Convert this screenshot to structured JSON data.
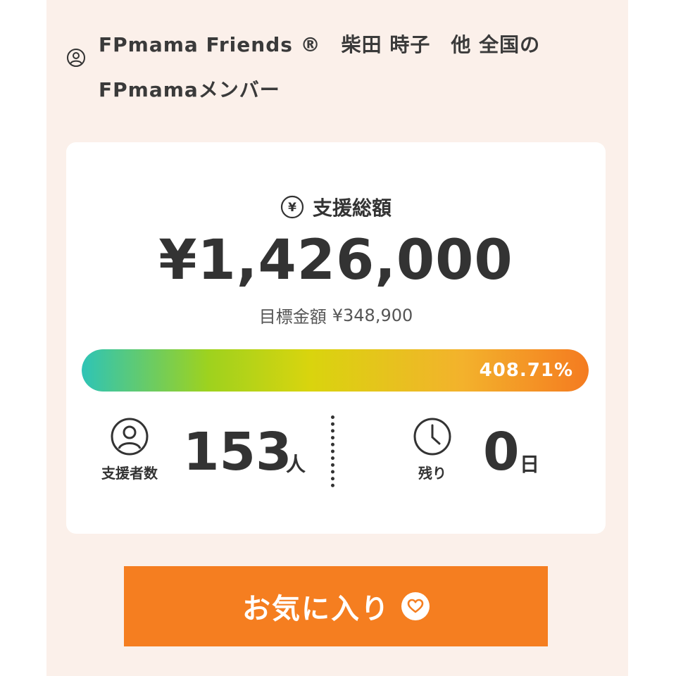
{
  "project_owner": {
    "icon": "user-circle-icon",
    "name": "FPmama Friends ®　柴田 時子　他 全国のFPmamaメンバー"
  },
  "funding": {
    "total_icon": "yen-icon",
    "total_label": "支援総額",
    "total_amount": "¥1,426,000",
    "goal_label": "目標金額",
    "goal_amount": "¥348,900",
    "progress_text": "408.71%",
    "progress_fill_fraction": 1.0,
    "gradient_colors": [
      "#2ec4b6",
      "#9ed21e",
      "#d9d40e",
      "#f3b22c",
      "#f47b20"
    ]
  },
  "stats": {
    "supporters": {
      "icon": "user-circle-icon",
      "label": "支援者数",
      "value": "153",
      "unit": "人"
    },
    "remaining": {
      "icon": "clock-icon",
      "label": "残り",
      "value": "0",
      "unit": "日"
    }
  },
  "favorite_button": {
    "label": "お気に入り",
    "icon": "heart-icon",
    "color": "#f57e20"
  },
  "colors": {
    "page_background": "#fbf0ea",
    "card_background": "#ffffff",
    "text": "#333333"
  }
}
